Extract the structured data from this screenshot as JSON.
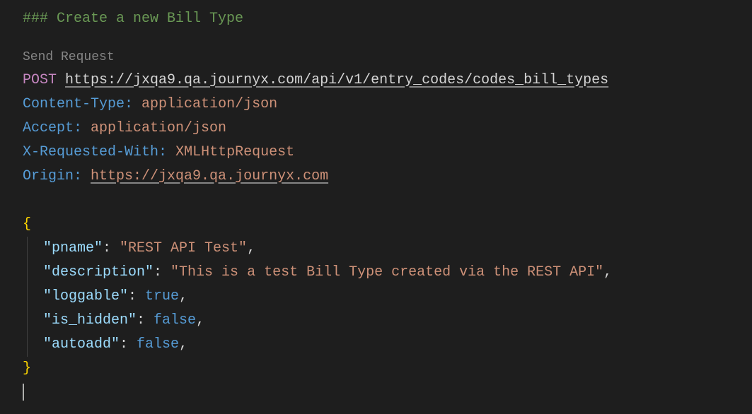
{
  "comment": "### Create a new Bill Type",
  "sendRequest": "Send Request",
  "request": {
    "method": "POST",
    "url": "https://jxqa9.qa.journyx.com/api/v1/entry_codes/codes_bill_types",
    "headers": {
      "contentType": {
        "key": "Content-Type:",
        "value": "application/json"
      },
      "accept": {
        "key": "Accept:",
        "value": "application/json"
      },
      "xRequestedWith": {
        "key": "X-Requested-With:",
        "value": "XMLHttpRequest"
      },
      "origin": {
        "key": "Origin:",
        "value": "https://jxqa9.qa.journyx.com"
      }
    },
    "body": {
      "braceOpen": "{",
      "braceClose": "}",
      "pname": {
        "key": "\"pname\"",
        "value": "\"REST API Test\""
      },
      "description": {
        "key": "\"description\"",
        "value": "\"This is a test Bill Type created via the REST API\""
      },
      "loggable": {
        "key": "\"loggable\"",
        "value": "true"
      },
      "is_hidden": {
        "key": "\"is_hidden\"",
        "value": "false"
      },
      "autoadd": {
        "key": "\"autoadd\"",
        "value": "false"
      }
    }
  }
}
